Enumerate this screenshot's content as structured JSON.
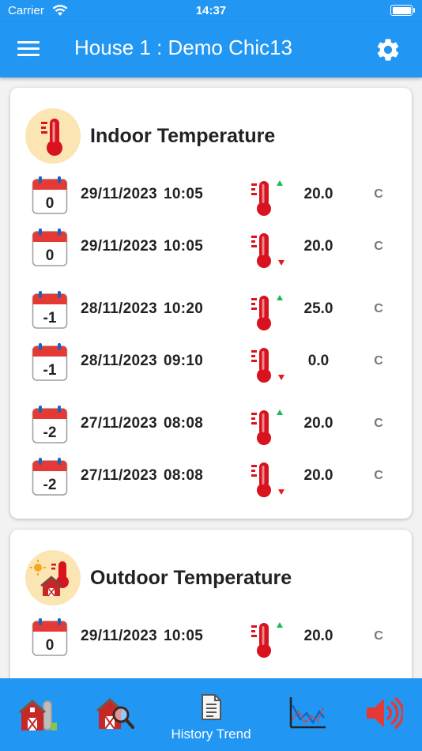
{
  "status_bar": {
    "carrier": "Carrier",
    "time": "14:37",
    "battery_level": 1.0
  },
  "app_bar": {
    "title": "House 1 : Demo Chic13",
    "menu_icon": "hamburger-menu-icon",
    "settings_icon": "gear-icon"
  },
  "indoor": {
    "title": "Indoor Temperature",
    "icon": "indoor-thermometer-icon",
    "rows": [
      {
        "day": "0",
        "date": "29/11/2023",
        "time": "10:05",
        "trend": "up",
        "value": "20.0",
        "unit": "C"
      },
      {
        "day": "0",
        "date": "29/11/2023",
        "time": "10:05",
        "trend": "down",
        "value": "20.0",
        "unit": "C"
      },
      {
        "day": "-1",
        "date": "28/11/2023",
        "time": "10:20",
        "trend": "up",
        "value": "25.0",
        "unit": "C"
      },
      {
        "day": "-1",
        "date": "28/11/2023",
        "time": "09:10",
        "trend": "down",
        "value": "0.0",
        "unit": "C"
      },
      {
        "day": "-2",
        "date": "27/11/2023",
        "time": "08:08",
        "trend": "up",
        "value": "20.0",
        "unit": "C"
      },
      {
        "day": "-2",
        "date": "27/11/2023",
        "time": "08:08",
        "trend": "down",
        "value": "20.0",
        "unit": "C"
      }
    ]
  },
  "outdoor": {
    "title": "Outdoor Temperature",
    "icon": "outdoor-barn-thermometer-icon",
    "rows": [
      {
        "day": "0",
        "date": "29/11/2023",
        "time": "10:05",
        "trend": "up",
        "value": "20.0",
        "unit": "C"
      }
    ]
  },
  "tab_bar": {
    "tabs": [
      {
        "icon": "barn-silo-icon",
        "label": ""
      },
      {
        "icon": "barn-search-icon",
        "label": ""
      },
      {
        "icon": "document-icon",
        "label": "History Trend"
      },
      {
        "icon": "line-chart-icon",
        "label": ""
      },
      {
        "icon": "speaker-icon",
        "label": ""
      }
    ]
  },
  "colors": {
    "primary": "#2196f3",
    "thermo_red": "#d8121e",
    "trend_up": "#1db954",
    "trend_down": "#e31b1b",
    "icon_bg": "#fbe5b3"
  }
}
